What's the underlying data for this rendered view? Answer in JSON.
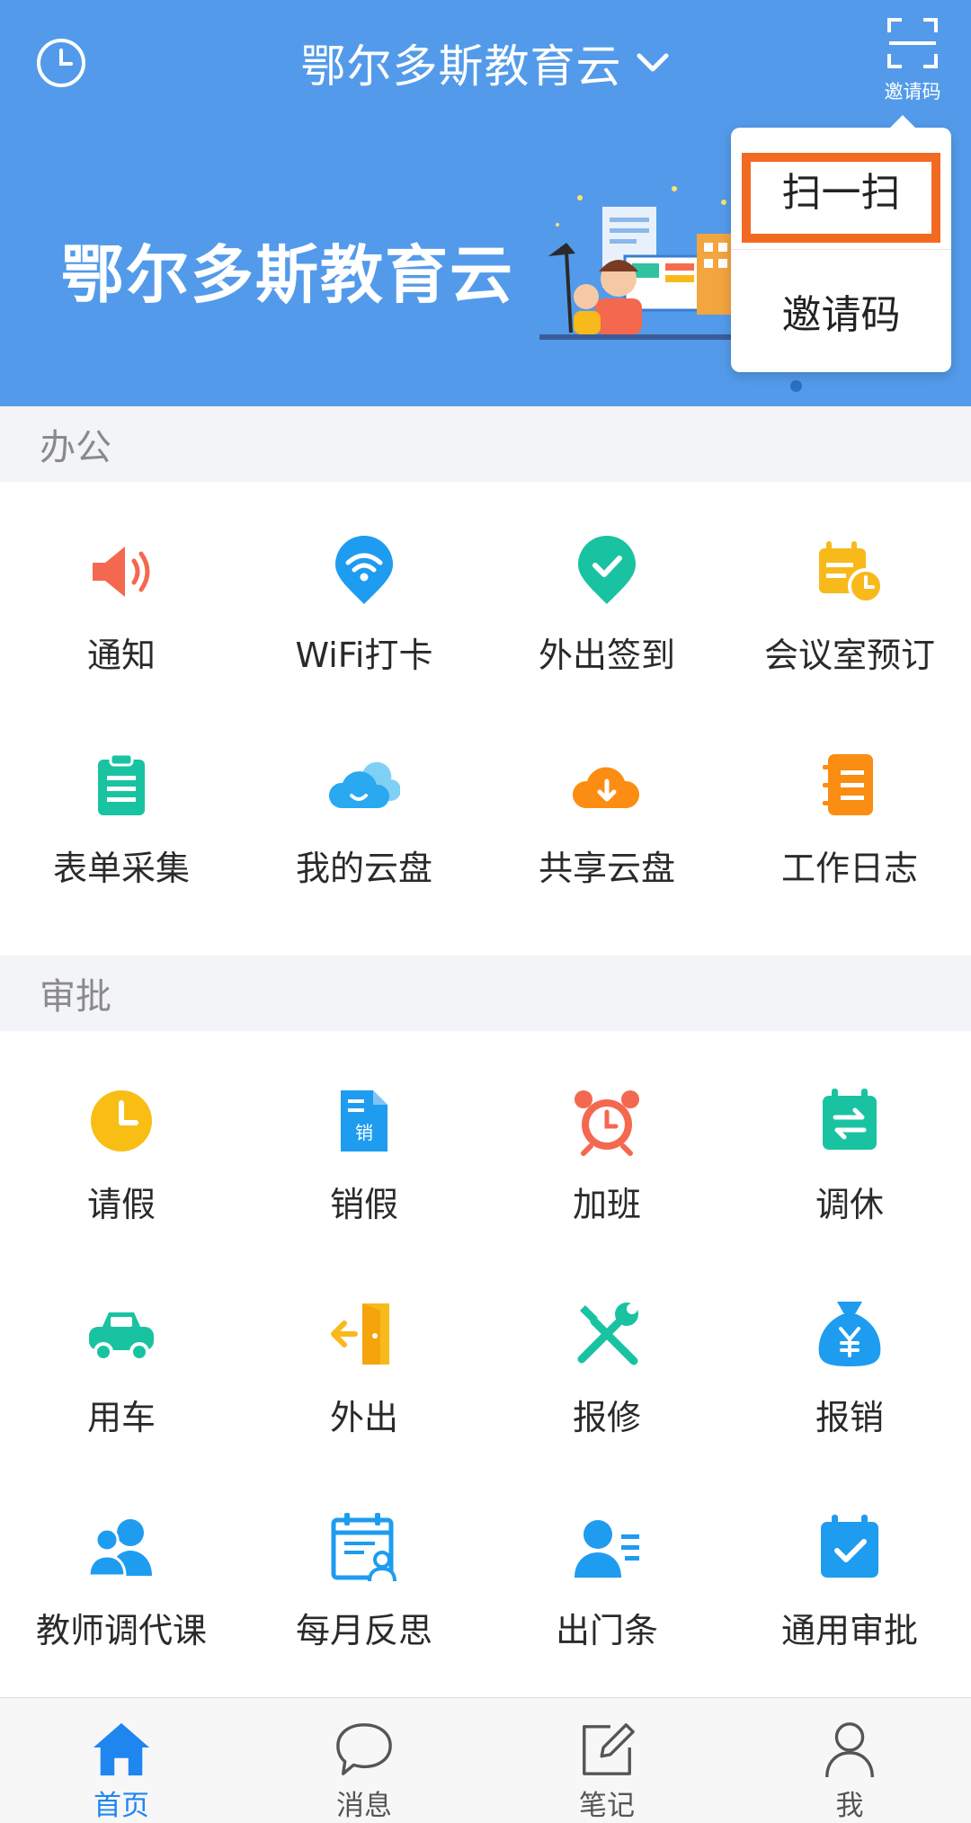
{
  "header": {
    "title": "鄂尔多斯教育云",
    "scan_label": "邀请码"
  },
  "banner": {
    "title": "鄂尔多斯教育云"
  },
  "popup": {
    "items": [
      "扫一扫",
      "邀请码"
    ],
    "highlight_color": "#f26a22"
  },
  "sections": {
    "office": "办公",
    "approval": "审批"
  },
  "office_items": [
    {
      "label": "通知",
      "icon": "speaker-icon",
      "color": "#f4684f"
    },
    {
      "label": "WiFi打卡",
      "icon": "wifi-pin-icon",
      "color": "#1e9cf0"
    },
    {
      "label": "外出签到",
      "icon": "check-pin-icon",
      "color": "#19c3a1"
    },
    {
      "label": "会议室预订",
      "icon": "calendar-clock-icon",
      "color": "#f8b91b"
    },
    {
      "label": "表单采集",
      "icon": "clipboard-icon",
      "color": "#19c3a1"
    },
    {
      "label": "我的云盘",
      "icon": "cloud-icon",
      "color": "#2aa8f0"
    },
    {
      "label": "共享云盘",
      "icon": "cloud-download-icon",
      "color": "#fa8d12"
    },
    {
      "label": "工作日志",
      "icon": "notebook-icon",
      "color": "#fa8d12"
    }
  ],
  "approval_items": [
    {
      "label": "请假",
      "icon": "clock-icon",
      "color": "#f8be14"
    },
    {
      "label": "销假",
      "icon": "document-icon",
      "color": "#1e9cf0"
    },
    {
      "label": "加班",
      "icon": "alarm-clock-icon",
      "color": "#f4684f"
    },
    {
      "label": "调休",
      "icon": "swap-calendar-icon",
      "color": "#19c3a1"
    },
    {
      "label": "用车",
      "icon": "car-icon",
      "color": "#19c3a1"
    },
    {
      "label": "外出",
      "icon": "exit-door-icon",
      "color": "#f8b91b"
    },
    {
      "label": "报修",
      "icon": "tools-icon",
      "color": "#19c3a1"
    },
    {
      "label": "报销",
      "icon": "money-bag-icon",
      "color": "#1e9cf0"
    },
    {
      "label": "教师调代课",
      "icon": "people-icon",
      "color": "#1e9cf0"
    },
    {
      "label": "每月反思",
      "icon": "calendar-person-icon",
      "color": "#1e9cf0"
    },
    {
      "label": "出门条",
      "icon": "person-list-icon",
      "color": "#1e9cf0"
    },
    {
      "label": "通用审批",
      "icon": "calendar-check-icon",
      "color": "#1e9cf0"
    }
  ],
  "bottom_nav": [
    {
      "label": "首页",
      "icon": "home-icon",
      "active": true
    },
    {
      "label": "消息",
      "icon": "chat-icon",
      "active": false
    },
    {
      "label": "笔记",
      "icon": "note-icon",
      "active": false
    },
    {
      "label": "我",
      "icon": "user-icon",
      "active": false
    }
  ],
  "colors": {
    "header_bg": "#539bea",
    "accent": "#1f86f0"
  }
}
